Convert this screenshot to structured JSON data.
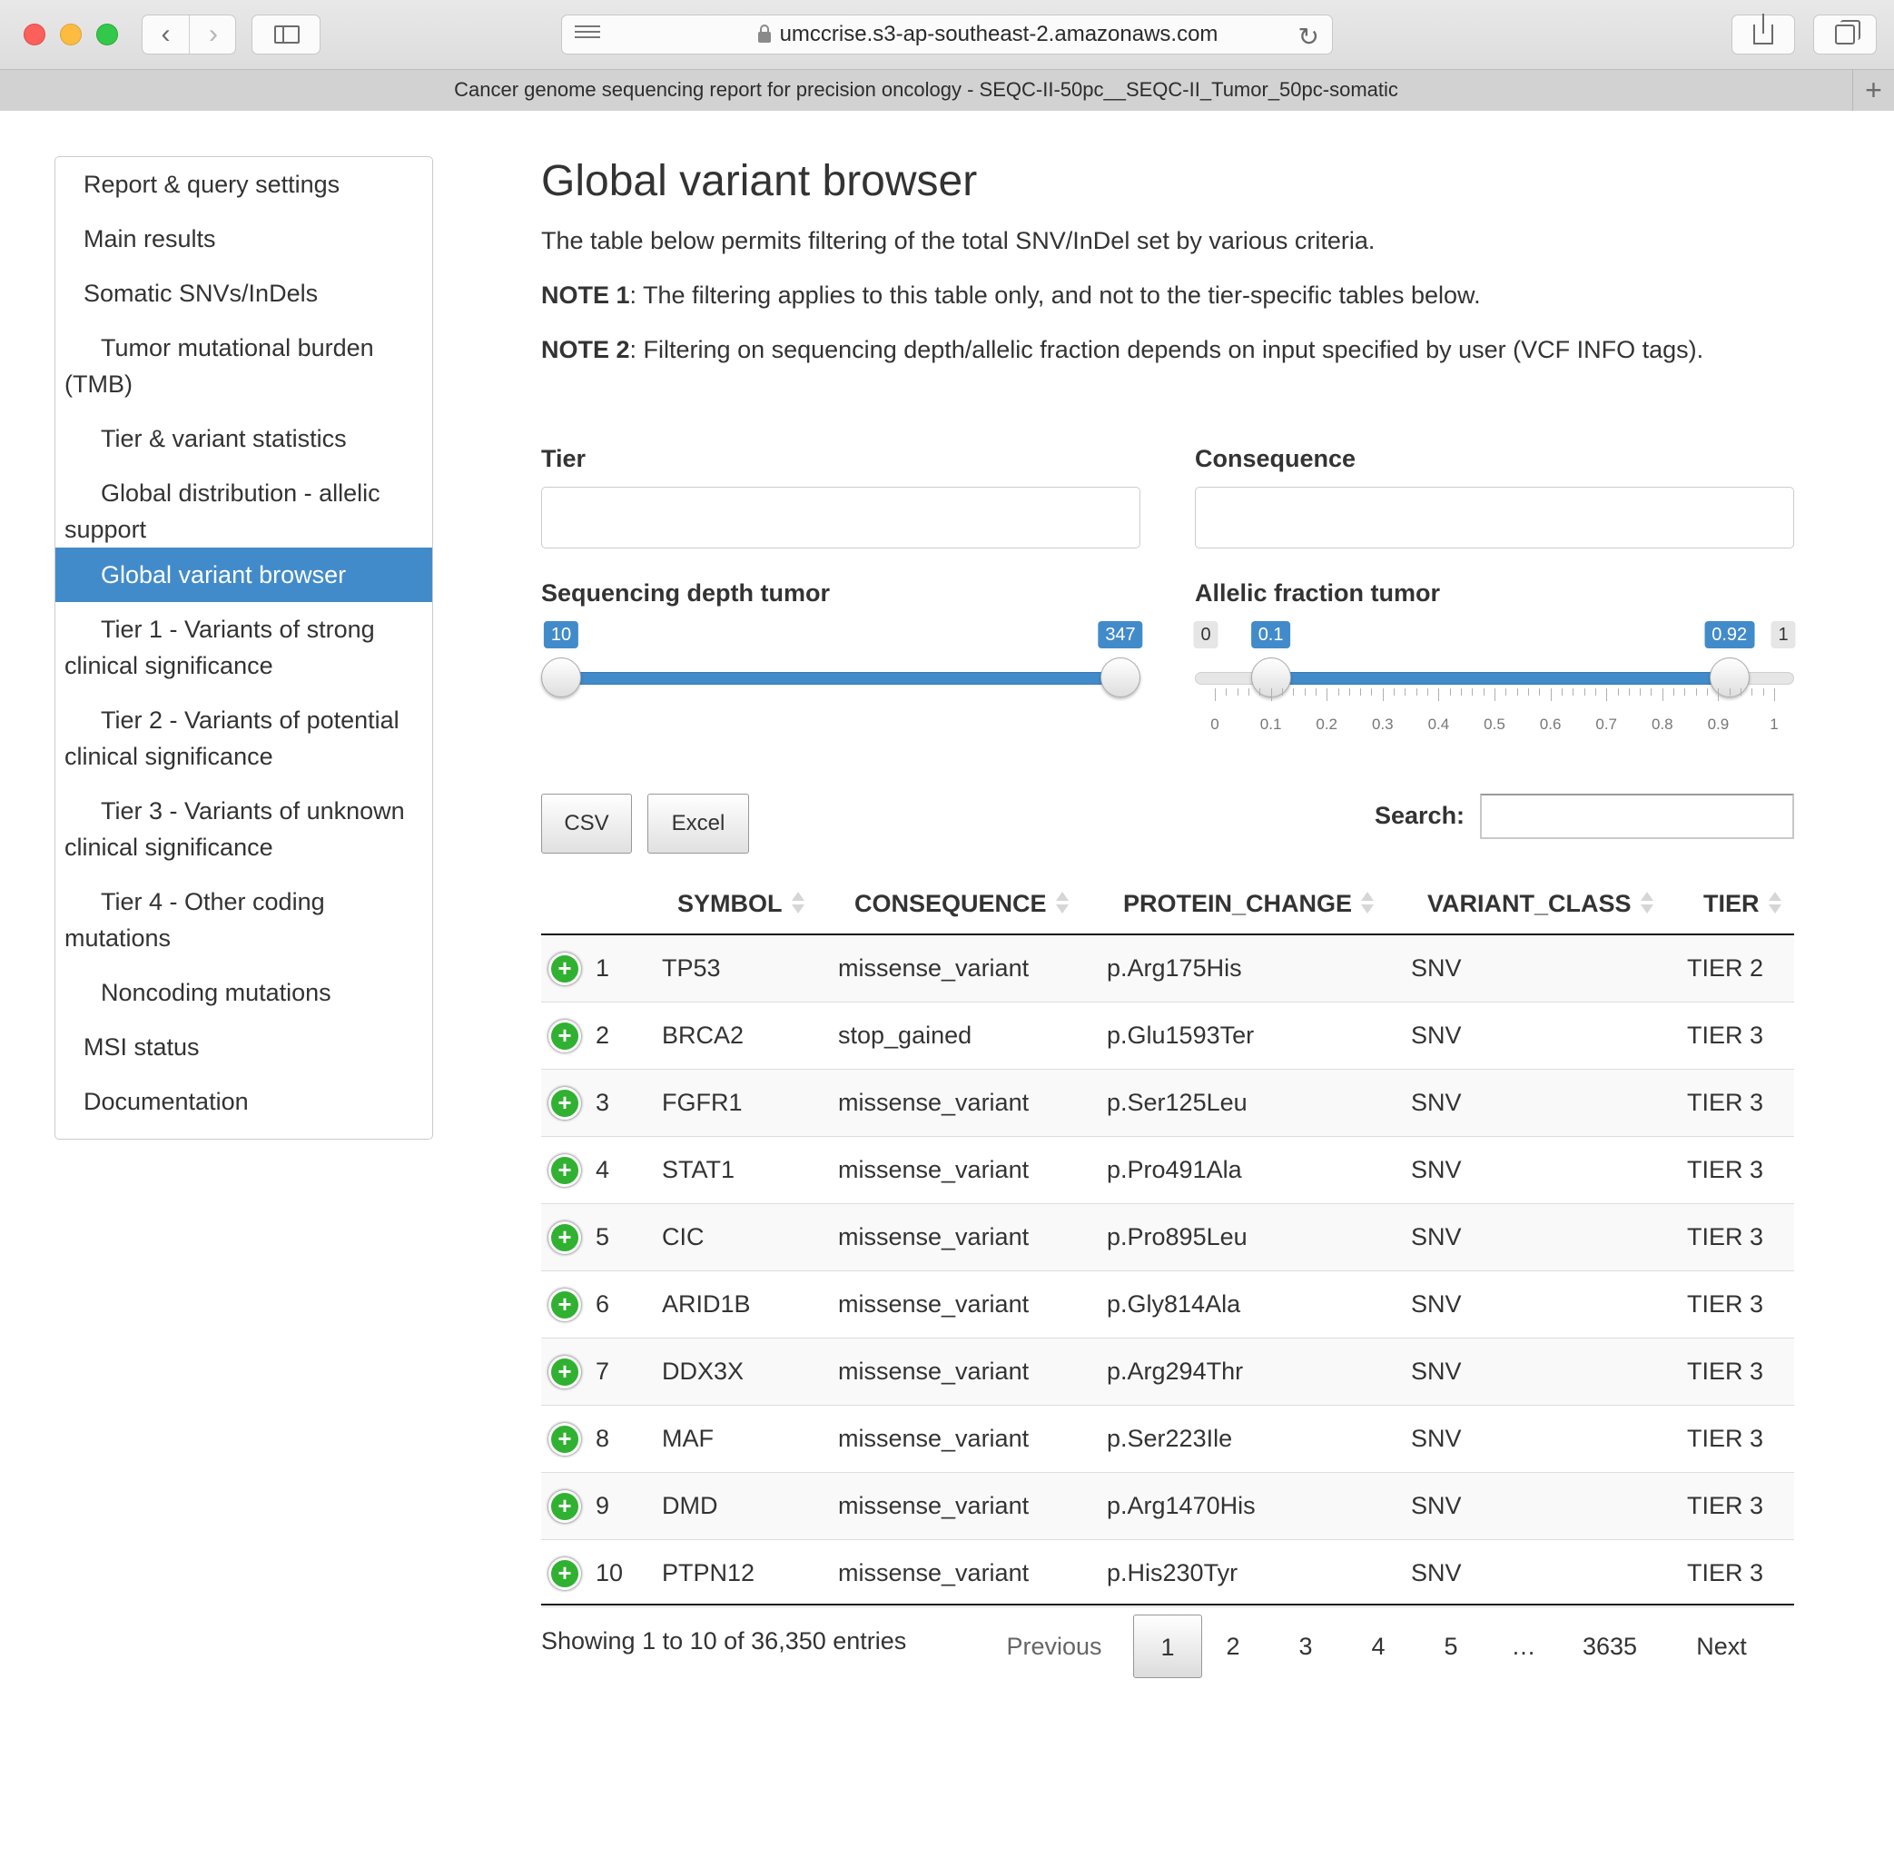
{
  "browser": {
    "url": "umccrise.s3-ap-southeast-2.amazonaws.com",
    "tab_title": "Cancer genome sequencing report for precision oncology - SEQC-II-50pc__SEQC-II_Tumor_50pc-somatic",
    "new_tab": "+"
  },
  "toc": {
    "items": [
      {
        "lines": [
          "Report & query settings"
        ]
      },
      {
        "lines": [
          "Main results"
        ]
      },
      {
        "lines": [
          "Somatic SNVs/InDels"
        ]
      },
      {
        "lines": [
          "Tumor mutational burden",
          "(TMB)"
        ]
      },
      {
        "lines": [
          "Tier & variant statistics"
        ]
      },
      {
        "lines": [
          "Global distribution - allelic",
          "support"
        ]
      },
      {
        "lines": [
          "Global variant browser"
        ]
      },
      {
        "lines": [
          "Tier 1 - Variants of strong",
          "clinical significance"
        ]
      },
      {
        "lines": [
          "Tier 2 - Variants of potential",
          "clinical significance"
        ]
      },
      {
        "lines": [
          "Tier 3 - Variants of unknown",
          "clinical significance"
        ]
      },
      {
        "lines": [
          "Tier 4 - Other coding",
          "mutations"
        ]
      },
      {
        "lines": [
          "Noncoding mutations"
        ]
      },
      {
        "lines": [
          "MSI status"
        ]
      },
      {
        "lines": [
          "Documentation"
        ]
      }
    ]
  },
  "main": {
    "title": "Global variant browser",
    "intro": "The table below permits filtering of the total SNV/InDel set by various criteria.",
    "note1_label": "NOTE 1",
    "note1_text": ": The filtering applies to this table only, and not to the tier-specific tables below.",
    "note2_label": "NOTE 2",
    "note2_text": ": Filtering on sequencing depth/allelic fraction depends on input specified by user (VCF INFO tags)."
  },
  "filters": {
    "tier_label": "Tier",
    "tier_value": "",
    "consequence_label": "Consequence",
    "consequence_value": "",
    "depth": {
      "label": "Sequencing depth tumor",
      "min": 10,
      "max": 347,
      "from": 10,
      "to": 347,
      "from_label": "10",
      "to_label": "347"
    },
    "af": {
      "label": "Allelic fraction tumor",
      "min": 0,
      "max": 1,
      "from": 0.1,
      "to": 0.92,
      "min_label": "0",
      "max_label": "1",
      "from_label": "0.1",
      "to_label": "0.92",
      "ticks": [
        "0",
        "0.1",
        "0.2",
        "0.3",
        "0.4",
        "0.5",
        "0.6",
        "0.7",
        "0.8",
        "0.9",
        "1"
      ]
    }
  },
  "toolbar": {
    "csv_label": "CSV",
    "excel_label": "Excel",
    "search_label": "Search:",
    "search_value": ""
  },
  "table": {
    "columns": [
      "SYMBOL",
      "CONSEQUENCE",
      "PROTEIN_CHANGE",
      "VARIANT_CLASS",
      "TIER"
    ],
    "rows": [
      {
        "n": "1",
        "symbol": "TP53",
        "consequence": "missense_variant",
        "protein_change": "p.Arg175His",
        "variant_class": "SNV",
        "tier": "TIER 2"
      },
      {
        "n": "2",
        "symbol": "BRCA2",
        "consequence": "stop_gained",
        "protein_change": "p.Glu1593Ter",
        "variant_class": "SNV",
        "tier": "TIER 3"
      },
      {
        "n": "3",
        "symbol": "FGFR1",
        "consequence": "missense_variant",
        "protein_change": "p.Ser125Leu",
        "variant_class": "SNV",
        "tier": "TIER 3"
      },
      {
        "n": "4",
        "symbol": "STAT1",
        "consequence": "missense_variant",
        "protein_change": "p.Pro491Ala",
        "variant_class": "SNV",
        "tier": "TIER 3"
      },
      {
        "n": "5",
        "symbol": "CIC",
        "consequence": "missense_variant",
        "protein_change": "p.Pro895Leu",
        "variant_class": "SNV",
        "tier": "TIER 3"
      },
      {
        "n": "6",
        "symbol": "ARID1B",
        "consequence": "missense_variant",
        "protein_change": "p.Gly814Ala",
        "variant_class": "SNV",
        "tier": "TIER 3"
      },
      {
        "n": "7",
        "symbol": "DDX3X",
        "consequence": "missense_variant",
        "protein_change": "p.Arg294Thr",
        "variant_class": "SNV",
        "tier": "TIER 3"
      },
      {
        "n": "8",
        "symbol": "MAF",
        "consequence": "missense_variant",
        "protein_change": "p.Ser223Ile",
        "variant_class": "SNV",
        "tier": "TIER 3"
      },
      {
        "n": "9",
        "symbol": "DMD",
        "consequence": "missense_variant",
        "protein_change": "p.Arg1470His",
        "variant_class": "SNV",
        "tier": "TIER 3"
      },
      {
        "n": "10",
        "symbol": "PTPN12",
        "consequence": "missense_variant",
        "protein_change": "p.His230Tyr",
        "variant_class": "SNV",
        "tier": "TIER 3"
      }
    ]
  },
  "footer": {
    "info": "Showing 1 to 10 of 36,350 entries",
    "previous": "Previous",
    "pages": [
      "1",
      "2",
      "3",
      "4",
      "5",
      "…",
      "3635"
    ],
    "current_page": "1",
    "next": "Next"
  }
}
